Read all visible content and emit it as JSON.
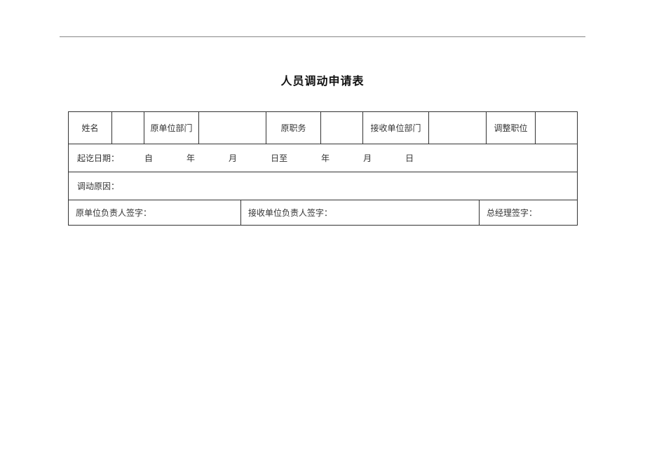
{
  "title": "人员调动申请表",
  "row1": {
    "name_label": "姓名",
    "name_value": "",
    "orig_dept_label": "原单位部门",
    "orig_dept_value": "",
    "orig_title_label": "原职务",
    "orig_title_value": "",
    "recv_dept_label": "接收单位部门",
    "recv_dept_value": "",
    "adj_title_label": "调整职位",
    "adj_title_value": ""
  },
  "row2": {
    "label": "起讫日期：",
    "from": "自",
    "year1": "年",
    "month1": "月",
    "to": "日至",
    "year2": "年",
    "month2": "月",
    "day2": "日"
  },
  "row3": {
    "reason_label": "调动原因："
  },
  "row4": {
    "sig_orig": "原单位负责人签字：",
    "sig_recv": "接收单位负责人签字：",
    "sig_gm": "总经理签字："
  }
}
